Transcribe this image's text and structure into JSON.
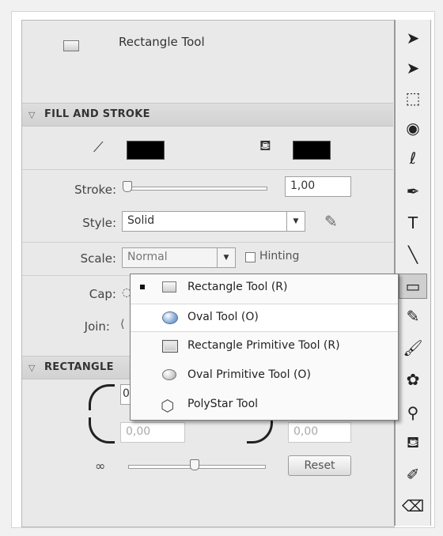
{
  "properties": {
    "tool_name": "Rectangle Tool",
    "fill_stroke": {
      "header": "FILL AND STROKE",
      "stroke_color": "#000000",
      "fill_color": "#000000",
      "stroke_label": "Stroke:",
      "stroke_value": "1,00",
      "style_label": "Style:",
      "style_value": "Solid",
      "scale_label": "Scale:",
      "scale_value": "Normal",
      "hinting_label": "Hinting",
      "cap_label": "Cap:",
      "join_label": "Join:"
    },
    "rectangle_options": {
      "header": "RECTANGLE",
      "corner_values": [
        "0",
        "0,00",
        "0,00"
      ],
      "reset_label": "Reset"
    }
  },
  "tool_menu": {
    "items": [
      {
        "label": "Rectangle Tool (R)",
        "icon": "rectangle-icon",
        "checked": true
      },
      {
        "label": "Oval Tool (O)",
        "icon": "oval-icon",
        "hover": true
      },
      {
        "label": "Rectangle Primitive Tool (R)",
        "icon": "rectangle-primitive-icon"
      },
      {
        "label": "Oval Primitive Tool (O)",
        "icon": "oval-primitive-icon"
      },
      {
        "label": "PolyStar Tool",
        "icon": "polystar-icon"
      }
    ]
  },
  "toolbar": {
    "tools": [
      {
        "name": "selection-tool",
        "glyph": "➤"
      },
      {
        "name": "subselection-tool",
        "glyph": "➤"
      },
      {
        "name": "free-transform-tool",
        "glyph": "⬚"
      },
      {
        "name": "3d-rotation-tool",
        "glyph": "◉"
      },
      {
        "name": "lasso-tool",
        "glyph": "ℓ"
      },
      {
        "name": "pen-tool",
        "glyph": "✒"
      },
      {
        "name": "text-tool",
        "glyph": "T"
      },
      {
        "name": "line-tool",
        "glyph": "╲"
      },
      {
        "name": "rectangle-tool",
        "glyph": "▭",
        "selected": true
      },
      {
        "name": "pencil-tool",
        "glyph": "✎"
      },
      {
        "name": "brush-tool",
        "glyph": "🖌"
      },
      {
        "name": "deco-tool",
        "glyph": "✿"
      },
      {
        "name": "bone-tool",
        "glyph": "⚲"
      },
      {
        "name": "paint-bucket-tool",
        "glyph": "⛾"
      },
      {
        "name": "eyedropper-tool",
        "glyph": "✐"
      },
      {
        "name": "eraser-tool",
        "glyph": "⌫"
      }
    ]
  }
}
